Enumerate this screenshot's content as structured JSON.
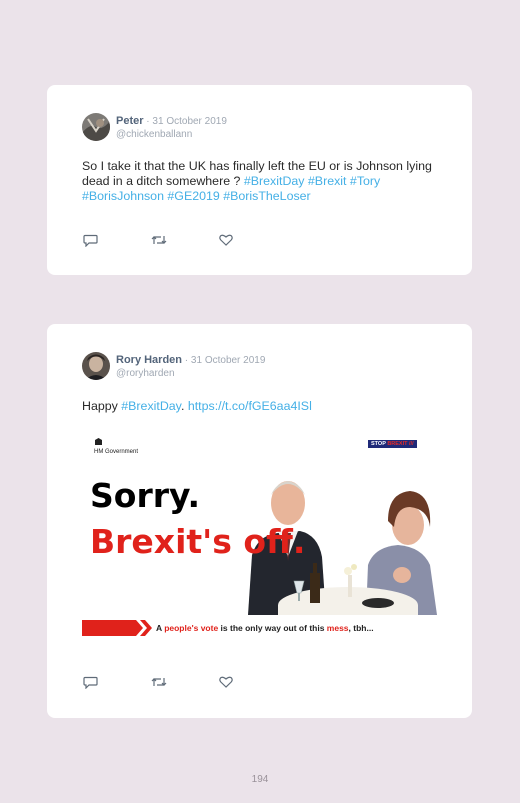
{
  "tweets": [
    {
      "name": "Peter",
      "date": " · 31 October 2019",
      "handle": "@chickenballann",
      "text_plain": "So I take it that the UK has finally left the EU or is Johnson lying dead in a ditch somewhere ? ",
      "hashtags": "#BrexitDay #Brexit #Tory #BorisJohnson #GE2019 #BorisTheLoser"
    },
    {
      "name": "Rory Harden",
      "date": " · 31 October 2019",
      "handle": "@roryharden",
      "text_prefix": "Happy ",
      "hashtag": "#BrexitDay",
      "text_mid": ". ",
      "link": "https://t.co/fGE6aa4ISl",
      "image": {
        "gov_label": "HM Government",
        "stop_label_1": "STOP ",
        "stop_label_2": "BREXIT",
        "headline_1": "Sorry.",
        "headline_2": "Brexit's off.",
        "banner_a": "A ",
        "banner_b": "people's vote",
        "banner_c": " is the only way out of this ",
        "banner_d": "mess",
        "banner_e": ", tbh..."
      }
    }
  ],
  "actions": [
    "reply-icon",
    "retweet-icon",
    "like-icon"
  ],
  "page_number": "194",
  "colors": {
    "background": "#ebe3ea",
    "link": "#45b0e6",
    "name": "#53647a",
    "meta": "#a0a8b3",
    "headline_red": "#e0221b"
  }
}
